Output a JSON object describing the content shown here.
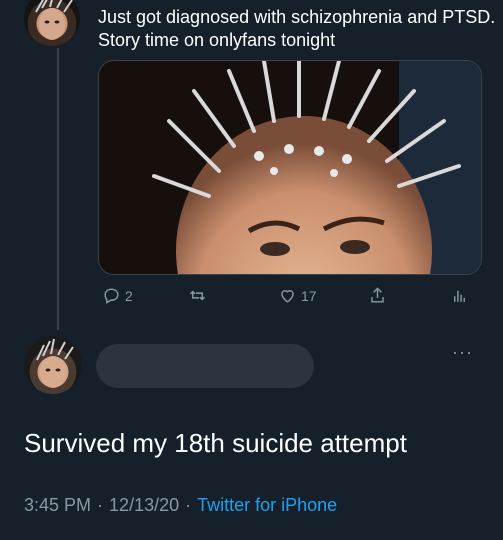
{
  "tweet1": {
    "text": "Just got diagnosed with schizophrenia and PTSD. Story time on onlyfans tonight",
    "replies": "2",
    "retweets": "",
    "likes": "17"
  },
  "tweet2": {
    "text": "Survived my 18th suicide attempt",
    "time": "3:45 PM",
    "separator": "·",
    "date": "12/13/20",
    "source": "Twitter for iPhone"
  },
  "icons": {
    "reply": "reply-icon",
    "retweet": "retweet-icon",
    "like": "heart-icon",
    "share": "share-icon",
    "analytics": "analytics-icon",
    "more": "more-icon"
  },
  "more_glyph": "···",
  "colors": {
    "background": "#15202b",
    "secondary_text": "#8899a6",
    "link": "#1da1f2",
    "divider": "#38444d"
  }
}
